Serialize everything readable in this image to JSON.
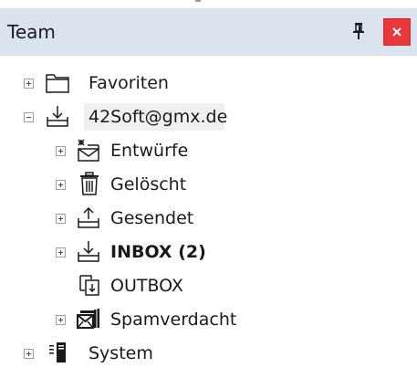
{
  "panel": {
    "title": "Team",
    "close_color": "#e8383b",
    "header_color": "#dbe3ee"
  },
  "tree": {
    "favorites": {
      "label": "Favoriten",
      "expander": "plus",
      "icon": "folder-icon"
    },
    "account": {
      "label": "42Soft@gmx.de",
      "expander": "minus",
      "icon": "inbox-tray-icon",
      "children": [
        {
          "label": "Entwürfe",
          "expander": "plus",
          "icon": "draft-envelope-icon"
        },
        {
          "label": "Gelöscht",
          "expander": "plus",
          "icon": "trash-icon"
        },
        {
          "label": "Gesendet",
          "expander": "plus",
          "icon": "outbox-tray-icon"
        },
        {
          "label": "INBOX (2)",
          "expander": "plus",
          "icon": "inbox-tray-icon",
          "bold": true
        },
        {
          "label": "OUTBOX",
          "expander": "none",
          "icon": "copy-docs-icon"
        },
        {
          "label": "Spamverdacht",
          "expander": "plus",
          "icon": "spam-icon"
        }
      ]
    },
    "system": {
      "label": "System",
      "expander": "plus",
      "icon": "server-icon"
    }
  }
}
